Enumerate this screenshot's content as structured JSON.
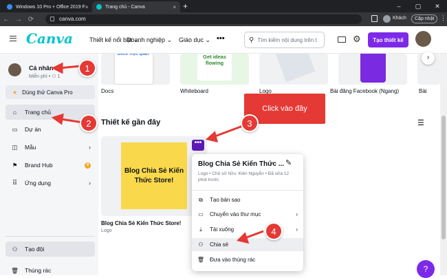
{
  "browser": {
    "tabs": [
      {
        "label": "Windows 10 Pro + Office 2019 F"
      },
      {
        "label": "Trang chủ - Canva"
      }
    ],
    "new_tab": "+",
    "url": "canva.com",
    "profile_label": "Khách",
    "update_label": "Cập nhật"
  },
  "header": {
    "logo": "Canva",
    "menu": [
      "Thiết kế nổi bật",
      "Doanh nghiệp",
      "Giáo dục"
    ],
    "more": "•••",
    "search_placeholder": "Tìm kiếm nội dung trên t",
    "create_button": "Tạo thiết kế"
  },
  "sidebar": {
    "profile_name": "Cá nhân",
    "profile_sub": "Miễn phí • ",
    "profile_members": "1",
    "try_pro": "Dùng thử Canva Pro",
    "items": [
      {
        "label": "Trang chủ"
      },
      {
        "label": "Dự án"
      },
      {
        "label": "Mẫu"
      },
      {
        "label": "Brand Hub"
      },
      {
        "label": "Ứng dụng"
      }
    ],
    "bottom_items": [
      {
        "label": "Tạo đội"
      },
      {
        "label": "Thùng rác"
      }
    ]
  },
  "main": {
    "templates": [
      {
        "label": "Docs",
        "thumb_text": "Docs Trực quan"
      },
      {
        "label": "Whiteboard",
        "thumb_text": "Get ideas flowing"
      },
      {
        "label": "Logo"
      },
      {
        "label": "Bài đăng Facebook (Ngang)"
      },
      {
        "label": "Bài"
      }
    ],
    "recent_title": "Thiết kế gần đây",
    "design_card": {
      "thumb_text": "Blog Chia Sẻ Kiến Thức Store!",
      "title": "Blog Chia Sẻ Kiến Thức Store!",
      "type": "Logo"
    }
  },
  "popup": {
    "title": "Blog Chia Sẻ Kiến Thức ...",
    "meta": "Logo • Chủ sở hữu: Kiên Nguyễn • Đã sửa 12 phút trước",
    "items": [
      {
        "label": "Tạo bản sao"
      },
      {
        "label": "Chuyển vào thư mục"
      },
      {
        "label": "Tải xuống"
      },
      {
        "label": "Chia sẻ"
      },
      {
        "label": "Đưa vào thùng rác"
      }
    ]
  },
  "annotations": {
    "tooltip": "Click vào đây",
    "badges": [
      "1",
      "2",
      "3",
      "4"
    ]
  },
  "help": "?",
  "colors": {
    "accent": "#7d2ae8",
    "logo": "#00c4cc",
    "annotation": "#e53935",
    "thumb_yellow": "#f9d84b"
  }
}
